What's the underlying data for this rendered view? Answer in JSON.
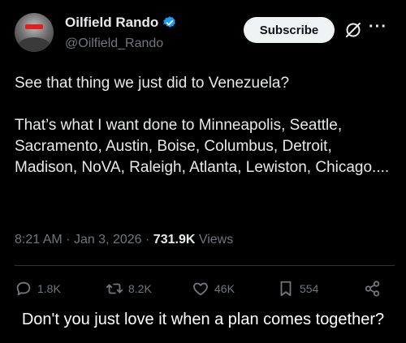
{
  "author": {
    "display_name": "Oilfield Rando",
    "handle": "@Oilfield_Rando"
  },
  "header": {
    "subscribe_label": "Subscribe",
    "more_label": "···"
  },
  "post": {
    "text": "See that thing we just did to Venezuela?\n\nThat’s what I want done to Minneapolis, Seattle, Sacramento, Austin, Boise, Columbus, Detroit, Madison, NoVA, Raleigh, Atlanta, Lewiston, Chicago....",
    "time": "8:21 AM",
    "date": "Jan 3, 2026",
    "views_count": "731.9K",
    "views_label": "Views"
  },
  "actions": {
    "replies": "1.8K",
    "reposts": "8.2K",
    "likes": "46K",
    "bookmarks": "554"
  },
  "caption": "Don't you just love it when a plan comes together?",
  "icons": [
    "verified-badge-icon",
    "grok-icon",
    "more-icon",
    "reply-icon",
    "repost-icon",
    "like-icon",
    "bookmark-icon",
    "share-icon"
  ],
  "colors": {
    "background": "#000000",
    "text": "#e7e9ea",
    "muted": "#71767b",
    "verified": "#1d9bf0"
  }
}
